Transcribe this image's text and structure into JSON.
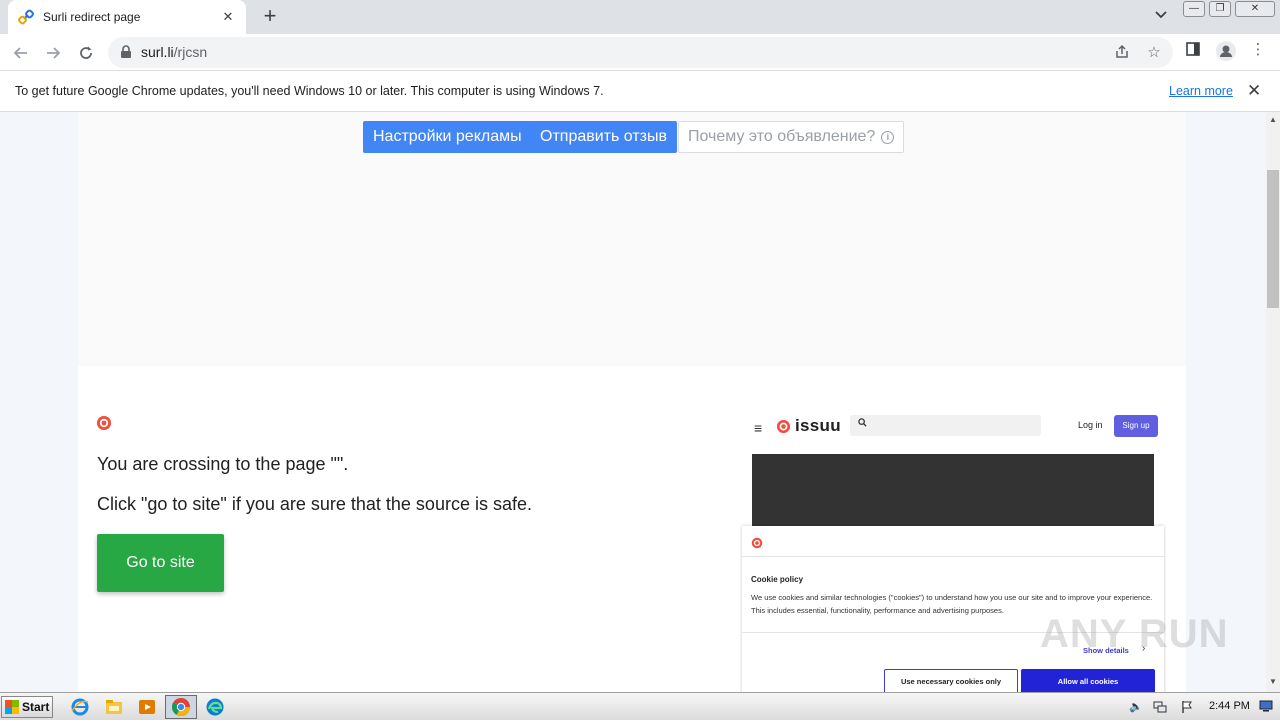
{
  "browser": {
    "tab": {
      "title": "Surli redirect page"
    },
    "url": {
      "host": "surl.li",
      "path": "/rjcsn"
    }
  },
  "infobar": {
    "message": "To get future Google Chrome updates, you'll need Windows 10 or later. This computer is using Windows 7.",
    "link": "Learn more"
  },
  "ad": {
    "settings_label": "Настройки рекламы",
    "feedback_label": "Отправить отзыв",
    "why_label": "Почему это объявление?"
  },
  "main": {
    "crossing_text": "You are crossing to the page \"\".",
    "safe_text": "Click \"go to site\" if you are sure that the source is safe.",
    "go_button": "Go to site"
  },
  "preview": {
    "brand": "issuu",
    "login": "Log in",
    "signup": "Sign up",
    "cookie": {
      "title": "Cookie policy",
      "text": "We use cookies and similar technologies (\"cookies\") to understand how you use our site and to improve your experience. This includes essential, functionality, performance and advertising purposes.",
      "show_details": "Show details",
      "necessary_only": "Use necessary cookies only",
      "allow_all": "Allow all cookies"
    }
  },
  "watermark": "ANY RUN",
  "taskbar": {
    "start_label": "Start",
    "clock": "2:44 PM"
  },
  "colors": {
    "go_button": "#28a745",
    "ad_blue": "#4285f4",
    "issuu_red": "#f24c3d",
    "signup_purple": "#5f5fe0",
    "cookie_blue": "#2222d6"
  }
}
